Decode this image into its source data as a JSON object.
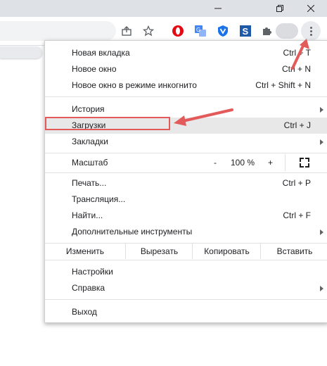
{
  "menu": {
    "items_top": [
      {
        "label": "Новая вкладка",
        "shortcut": "Ctrl + T"
      },
      {
        "label": "Новое окно",
        "shortcut": "Ctrl + N"
      },
      {
        "label": "Новое окно в режиме инкогнито",
        "shortcut": "Ctrl + Shift + N"
      }
    ],
    "history": {
      "label": "История"
    },
    "downloads": {
      "label": "Загрузки",
      "shortcut": "Ctrl + J"
    },
    "bookmarks": {
      "label": "Закладки"
    },
    "zoom": {
      "label": "Масштаб",
      "minus": "-",
      "value": "100 %",
      "plus": "+"
    },
    "print": {
      "label": "Печать...",
      "shortcut": "Ctrl + P"
    },
    "cast": {
      "label": "Трансляция..."
    },
    "find": {
      "label": "Найти...",
      "shortcut": "Ctrl + F"
    },
    "more_tools": {
      "label": "Дополнительные инструменты"
    },
    "edit": {
      "label": "Изменить",
      "cut": "Вырезать",
      "copy": "Копировать",
      "paste": "Вставить"
    },
    "settings": {
      "label": "Настройки"
    },
    "help": {
      "label": "Справка"
    },
    "exit": {
      "label": "Выход"
    }
  },
  "toolbar": {
    "icons": [
      "share-icon",
      "star-icon",
      "opera-icon",
      "translate-icon",
      "vpn-shield-icon",
      "s-extension-icon",
      "puzzle-extensions-icon",
      "profile-avatar",
      "menu-dots-icon"
    ]
  },
  "colors": {
    "annotation": "#e35a5a",
    "highlight": "#e8e8e8"
  }
}
